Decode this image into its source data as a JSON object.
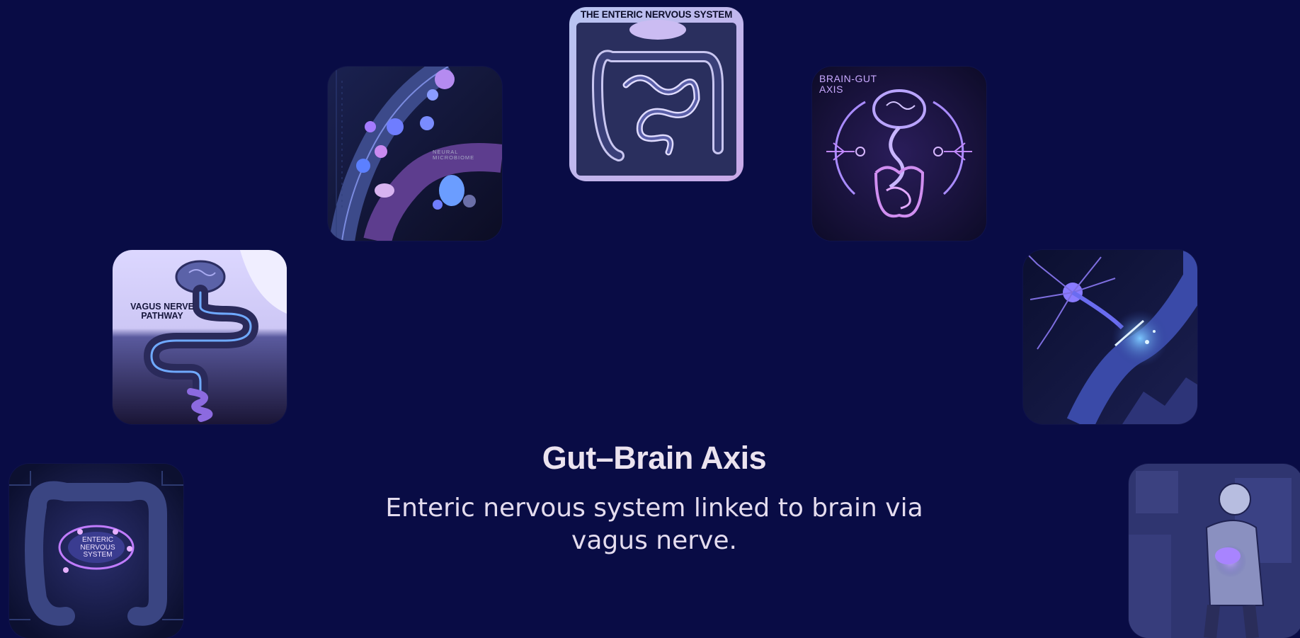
{
  "title": "Gut–Brain Axis",
  "subtitle": "Enteric nervous system linked to brain via vagus nerve.",
  "colors": {
    "background": "#090c45",
    "title_text": "#ebe3ef",
    "accent_purple": "#8b6bff",
    "accent_blue": "#4fb3ff"
  },
  "cards": {
    "enteric": {
      "label": "THE ENTERIC NERVOUS SYSTEM",
      "icon": "intestine-illustration"
    },
    "microbiome": {
      "label": "NEURAL MICROBIOME",
      "icon": "microbe-illustration"
    },
    "braingut": {
      "label": "BRAIN-GUT\nAXIS",
      "icon": "brain-gut-illustration"
    },
    "vagus": {
      "label": "VAGUS NERVE\nPATHWAY",
      "icon": "vagus-nerve-illustration"
    },
    "neuron": {
      "icon": "neuron-synapse-illustration"
    },
    "ens2": {
      "label": "ENTERIC\nNERVOUS\nSYSTEM",
      "icon": "circuit-gut-illustration"
    },
    "person": {
      "icon": "person-with-stomach-ache-illustration"
    }
  }
}
